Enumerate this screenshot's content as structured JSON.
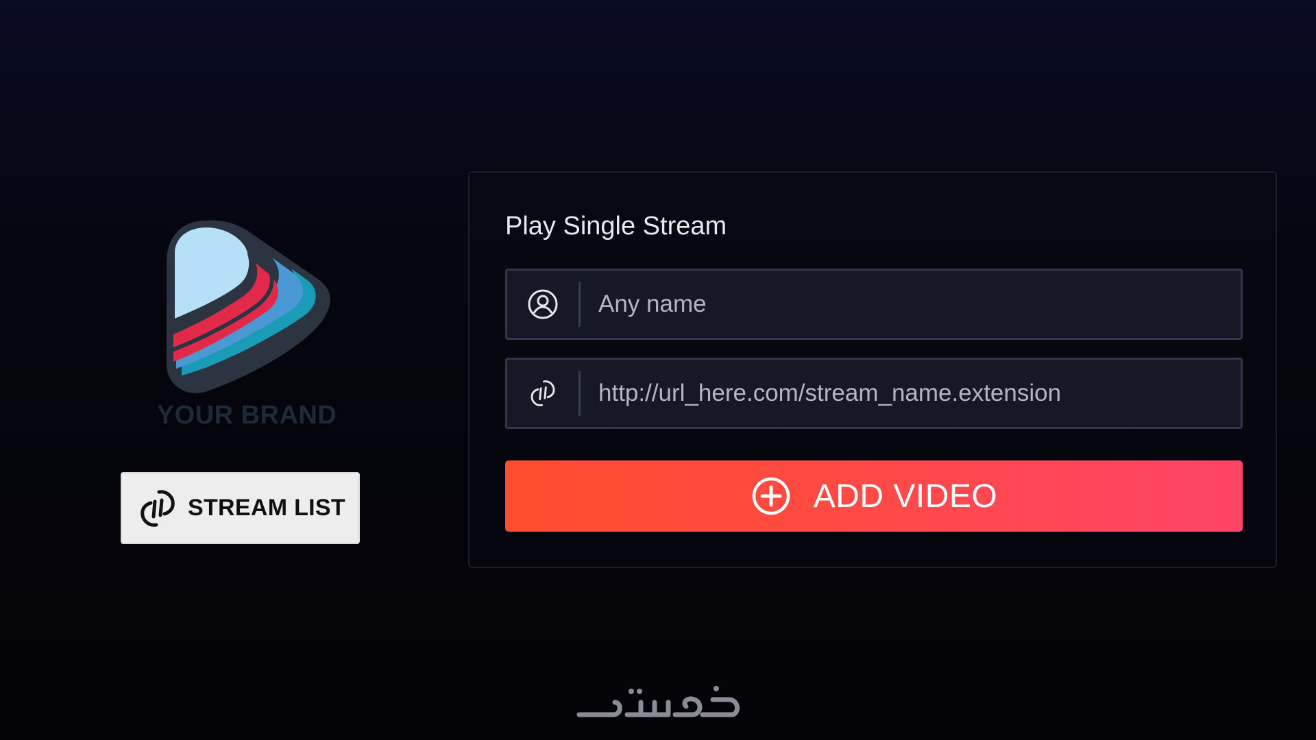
{
  "brand": {
    "name": "YOUR BRAND",
    "logo_icon": "play-logo-icon",
    "colors": {
      "light_blue": "#b6e0f7",
      "red": "#e3294a",
      "blue": "#4a98d4",
      "teal": "#1a9cb8",
      "outline": "#2b3440"
    }
  },
  "stream_list_button": {
    "label": "STREAM LIST",
    "icon": "link-icon"
  },
  "panel": {
    "title": "Play Single Stream",
    "name_field": {
      "placeholder": "Any name",
      "value": "",
      "icon": "user-icon"
    },
    "url_field": {
      "placeholder": "http://url_here.com/stream_name.extension",
      "value": "",
      "icon": "link-icon"
    },
    "add_button": {
      "label": "ADD VIDEO",
      "icon": "plus-circle-icon"
    }
  },
  "watermark": {
    "text": "خمسات"
  },
  "colors": {
    "background": "#05050d",
    "accent_start": "#ff4d2e",
    "accent_end": "#ff4468",
    "field_bg": "#171826",
    "field_border": "#33364a"
  }
}
